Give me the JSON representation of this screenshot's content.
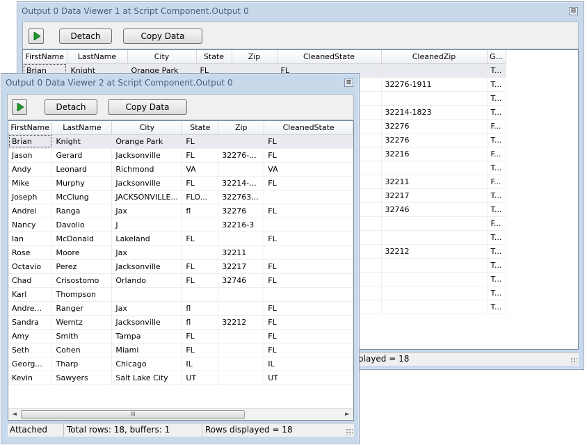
{
  "viewer1": {
    "title": "Output 0 Data Viewer 1 at Script Component.Output 0",
    "detach_label": "Detach",
    "copy_label": "Copy Data",
    "columns": [
      "FirstName",
      "LastName",
      "City",
      "State",
      "Zip",
      "CleanedState",
      "CleanedZip",
      "G..."
    ],
    "first_row": [
      "Brian",
      "Knight",
      "Orange Park",
      "FL",
      "",
      "FL",
      "",
      "T..."
    ],
    "cleaned_zip": [
      "",
      "32276-1911",
      "",
      "32214-1823",
      "32276",
      "32276",
      "32216",
      "",
      "32211",
      "32217",
      "32746",
      "",
      "",
      "32212",
      "",
      "",
      "",
      ""
    ],
    "last_col": [
      "T...",
      "T...",
      "T...",
      "T...",
      "F...",
      "T...",
      "F...",
      "T...",
      "F...",
      "T...",
      "T...",
      "F...",
      "T...",
      "T...",
      "T...",
      "T...",
      "T...",
      "T..."
    ],
    "status_partial": "played = 18"
  },
  "viewer2": {
    "title": "Output 0 Data Viewer 2 at Script Component.Output 0",
    "detach_label": "Detach",
    "copy_label": "Copy Data",
    "columns": [
      "FirstName",
      "LastName",
      "City",
      "State",
      "Zip",
      "CleanedState"
    ],
    "rows": [
      [
        "Brian",
        "Knight",
        "Orange Park",
        "FL",
        "",
        "FL"
      ],
      [
        "Jason",
        "Gerard",
        "Jacksonville",
        "FL",
        "32276-...",
        "FL"
      ],
      [
        "Andy",
        "Leonard",
        "Richmond",
        "VA",
        "",
        "VA"
      ],
      [
        "Mike",
        "Murphy",
        "Jacksonville",
        "FL",
        "32214-...",
        "FL"
      ],
      [
        "Joseph",
        "McClung",
        "JACKSONVILLE...",
        "FLO...",
        "322763...",
        ""
      ],
      [
        "Andrei",
        "Ranga",
        "Jax",
        "fl",
        "32276",
        "FL"
      ],
      [
        "Nancy",
        "Davolio",
        "J",
        "",
        "32216-3",
        ""
      ],
      [
        "Ian",
        "McDonald",
        "Lakeland",
        "FL",
        "",
        "FL"
      ],
      [
        "Rose",
        "Moore",
        "Jax",
        "",
        "32211",
        ""
      ],
      [
        "Octavio",
        "Perez",
        "Jacksonville",
        "FL",
        "32217",
        "FL"
      ],
      [
        "Chad",
        "Crisostomo",
        "Orlando",
        "FL",
        "32746",
        "FL"
      ],
      [
        "Karl",
        "Thompson",
        "",
        "",
        "",
        ""
      ],
      [
        "Andre...",
        "Ranger",
        "Jax",
        "fl",
        "",
        "FL"
      ],
      [
        "Sandra",
        "Werntz",
        "Jacksonville",
        "fl",
        "32212",
        "FL"
      ],
      [
        "Amy",
        "Smith",
        "Tampa",
        "FL",
        "",
        "FL"
      ],
      [
        "Seth",
        "Cohen",
        "Miami",
        "FL",
        "",
        "FL"
      ],
      [
        "Georg...",
        "Tharp",
        "Chicago",
        "IL",
        "",
        "IL"
      ],
      [
        "Kevin",
        "Sawyers",
        "Salt Lake City",
        "UT",
        "",
        "UT"
      ]
    ],
    "status": {
      "attached": "Attached",
      "total": "Total rows: 18, buffers: 1",
      "displayed": "Rows displayed = 18"
    },
    "scroll_thumb_glyph": "III"
  },
  "icons": {
    "close": "⊠",
    "play": "play-icon",
    "scroll_left": "◄",
    "scroll_right": "►"
  },
  "colors": {
    "window_bg": "#c9d9ec",
    "title_text": "#4a6078",
    "play_green": "#1f9a2b",
    "selected_row": "#e8eaf0"
  }
}
